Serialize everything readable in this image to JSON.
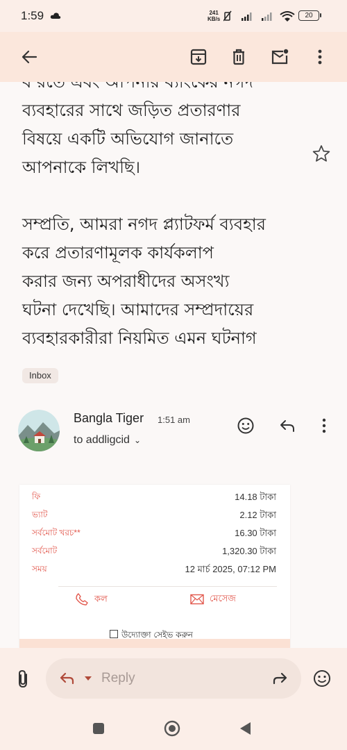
{
  "status_bar": {
    "time": "1:59",
    "net_speed_value": "241",
    "net_speed_unit": "KB/s",
    "battery": "20"
  },
  "toolbar": {
    "icons": [
      "back-arrow-icon",
      "archive-icon",
      "delete-icon",
      "mark-unread-icon",
      "more-vert-icon"
    ]
  },
  "message_body": {
    "line_partial": "ব রতে এবং আপনার ব্যাংকের নগদ",
    "paragraph1": [
      "ব্যবহারের সাথে জড়িত প্রতারণার",
      "বিষয়ে একটি অভিযোগ জানাতে",
      "আপনাকে লিখছি।"
    ],
    "paragraph2": [
      "সম্প্রতি, আমরা নগদ প্ল্যাটফর্ম ব্যবহার",
      "করে প্রতারণামূলক কার্যকলাপ",
      "করার জন্য অপরাধীদের অসংখ্য",
      "ঘটনা দেখেছি। আমাদের সম্প্রদায়ের",
      "ব্যবহারকারীরা নিয়মিত এমন ঘটনাগ"
    ],
    "label": "Inbox"
  },
  "message": {
    "sender": "Bangla Tiger",
    "time": "1:51 am",
    "recipient": "to addligcid",
    "chevron": "⌄"
  },
  "receipt": {
    "rows": [
      {
        "label": "ফি",
        "value": "14.18 টাকা"
      },
      {
        "label": "ভ্যাট",
        "value": "2.12 টাকা"
      },
      {
        "label": "সর্বমোট খরচ**",
        "value": "16.30 টাকা"
      },
      {
        "label": "সর্বমোট",
        "value": "1,320.30 টাকা"
      },
      {
        "label": "সময়",
        "value": "12 মার্চ 2025, 07:12 PM"
      }
    ],
    "call_label": "কল",
    "message_label": "মেসেজ",
    "save_recipient": "উদ্যোক্তা সেইভ করুন",
    "accent": "#e2574c"
  },
  "compose": {
    "reply_placeholder": "Reply"
  }
}
